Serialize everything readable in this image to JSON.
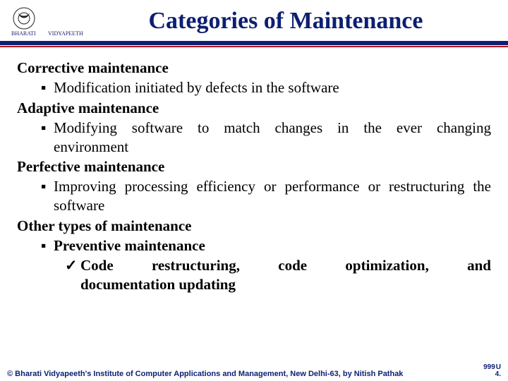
{
  "title": "Categories of Maintenance",
  "sections": {
    "corrective": {
      "heading": "Corrective maintenance",
      "bullet": "Modification initiated by defects in the software"
    },
    "adaptive": {
      "heading": "Adaptive maintenance",
      "bullet": "Modifying software to match changes in the ever changing environment"
    },
    "perfective": {
      "heading": "Perfective maintenance",
      "bullet": "Improving processing efficiency or performance or restructuring the software"
    },
    "other": {
      "heading": "Other types of maintenance",
      "bullet": "Preventive maintenance",
      "check_words": [
        "Code",
        "restructuring,",
        "code",
        "optimization,",
        "and"
      ],
      "check_line2": "documentation updating"
    }
  },
  "just_adapt": [
    "Modifying",
    "software",
    "to",
    "match",
    "changes",
    "in",
    "the",
    "ever",
    "changing"
  ],
  "footer": {
    "text": "© Bharati Vidyapeeth's Institute of Computer Applications and Management, New Delhi-63, by  Nitish Pathak",
    "page_top": "999",
    "page_top_u": "U",
    "page_bottom": "4."
  },
  "bullet_char": "▪",
  "check_char": "✓"
}
